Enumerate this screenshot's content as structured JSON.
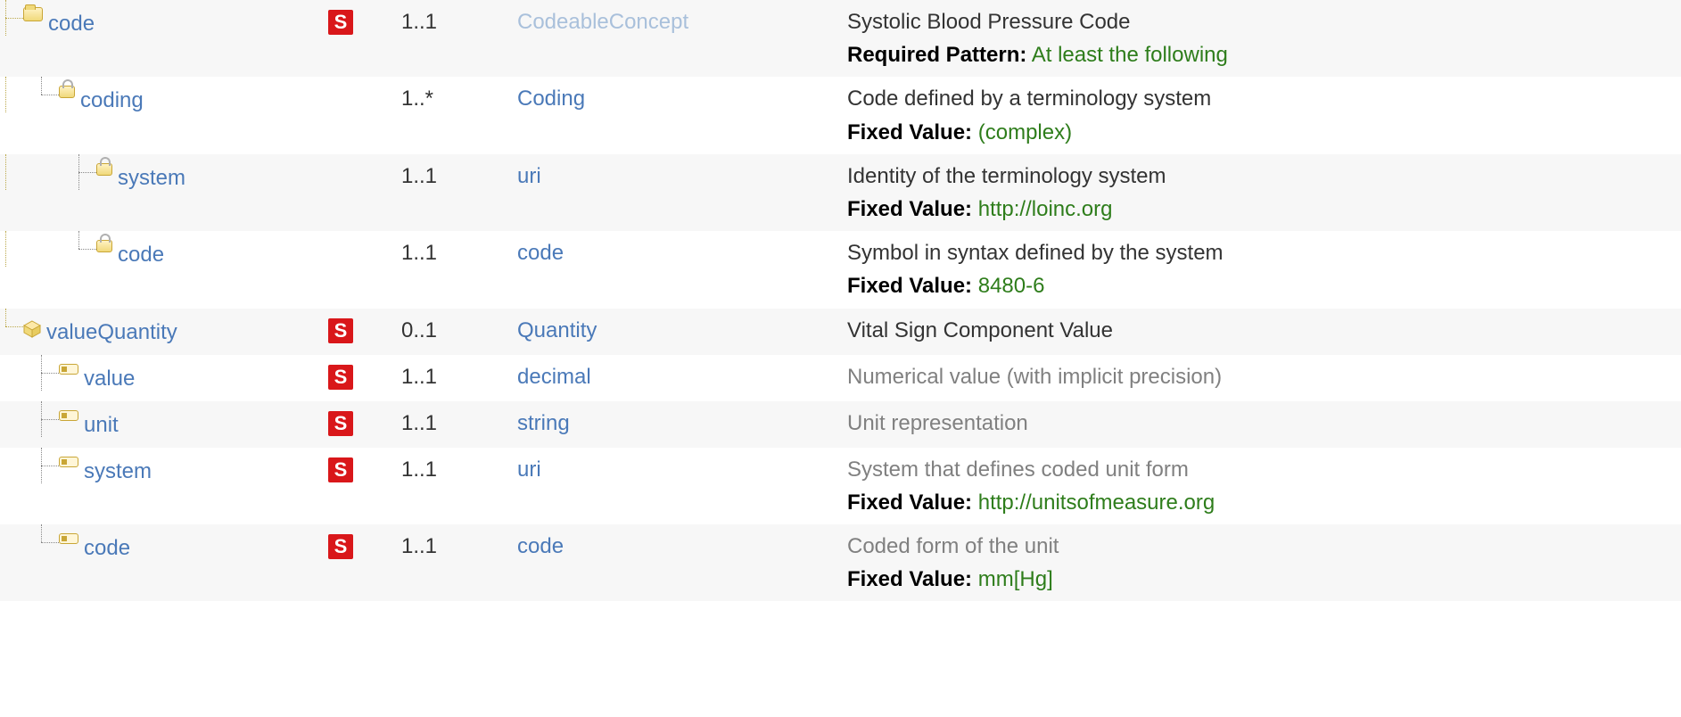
{
  "rows": [
    {
      "name": "code",
      "flag": "S",
      "card": "1..1",
      "type": "CodeableConcept",
      "type_muted": true,
      "desc": "Systolic Blood Pressure Code",
      "extraLabel": "Required Pattern:",
      "extraValue": "At least the following",
      "indent": 0,
      "icon": "folder",
      "goldStub": true
    },
    {
      "name": "coding",
      "flag": "",
      "card": "1..*",
      "type": "Coding",
      "desc": "Code defined by a terminology system",
      "extraLabel": "Fixed Value:",
      "extraValue": "(complex)",
      "indent": 1,
      "icon": "lock",
      "last": true
    },
    {
      "name": "system",
      "flag": "",
      "card": "1..1",
      "type": "uri",
      "desc": "Identity of the terminology system",
      "extraLabel": "Fixed Value:",
      "extraValue": "http://loinc.org",
      "indent": 2,
      "icon": "lock",
      "last": false
    },
    {
      "name": "code",
      "flag": "",
      "card": "1..1",
      "type": "code",
      "desc": "Symbol in syntax defined by the system",
      "extraLabel": "Fixed Value:",
      "extraValue": "8480-6",
      "indent": 2,
      "icon": "lock",
      "last": true
    },
    {
      "name": "valueQuantity",
      "flag": "S",
      "card": "0..1",
      "card_grey": true,
      "type": "Quantity",
      "desc": "Vital Sign Component Value",
      "indent": 0,
      "icon": "cube",
      "goldStub": true,
      "lastGold": true
    },
    {
      "name": "value",
      "flag": "S",
      "card": "1..1",
      "type": "decimal",
      "desc": "Numerical value (with implicit precision)",
      "desc_grey": true,
      "indent": 1,
      "icon": "field",
      "last": false
    },
    {
      "name": "unit",
      "flag": "S",
      "card": "1..1",
      "type": "string",
      "desc": "Unit representation",
      "desc_grey": true,
      "indent": 1,
      "icon": "field",
      "last": false
    },
    {
      "name": "system",
      "flag": "S",
      "card": "1..1",
      "type": "uri",
      "desc": "System that defines coded unit form",
      "desc_grey": true,
      "extraLabel": "Fixed Value:",
      "extraValue": "http://unitsofmeasure.org",
      "indent": 1,
      "icon": "field",
      "last": false
    },
    {
      "name": "code",
      "flag": "S",
      "card": "1..1",
      "type": "code",
      "desc": "Coded form of the unit",
      "desc_grey": true,
      "extraLabel": "Fixed Value:",
      "extraValue": "mm[Hg]",
      "indent": 1,
      "icon": "field",
      "last": true
    }
  ]
}
